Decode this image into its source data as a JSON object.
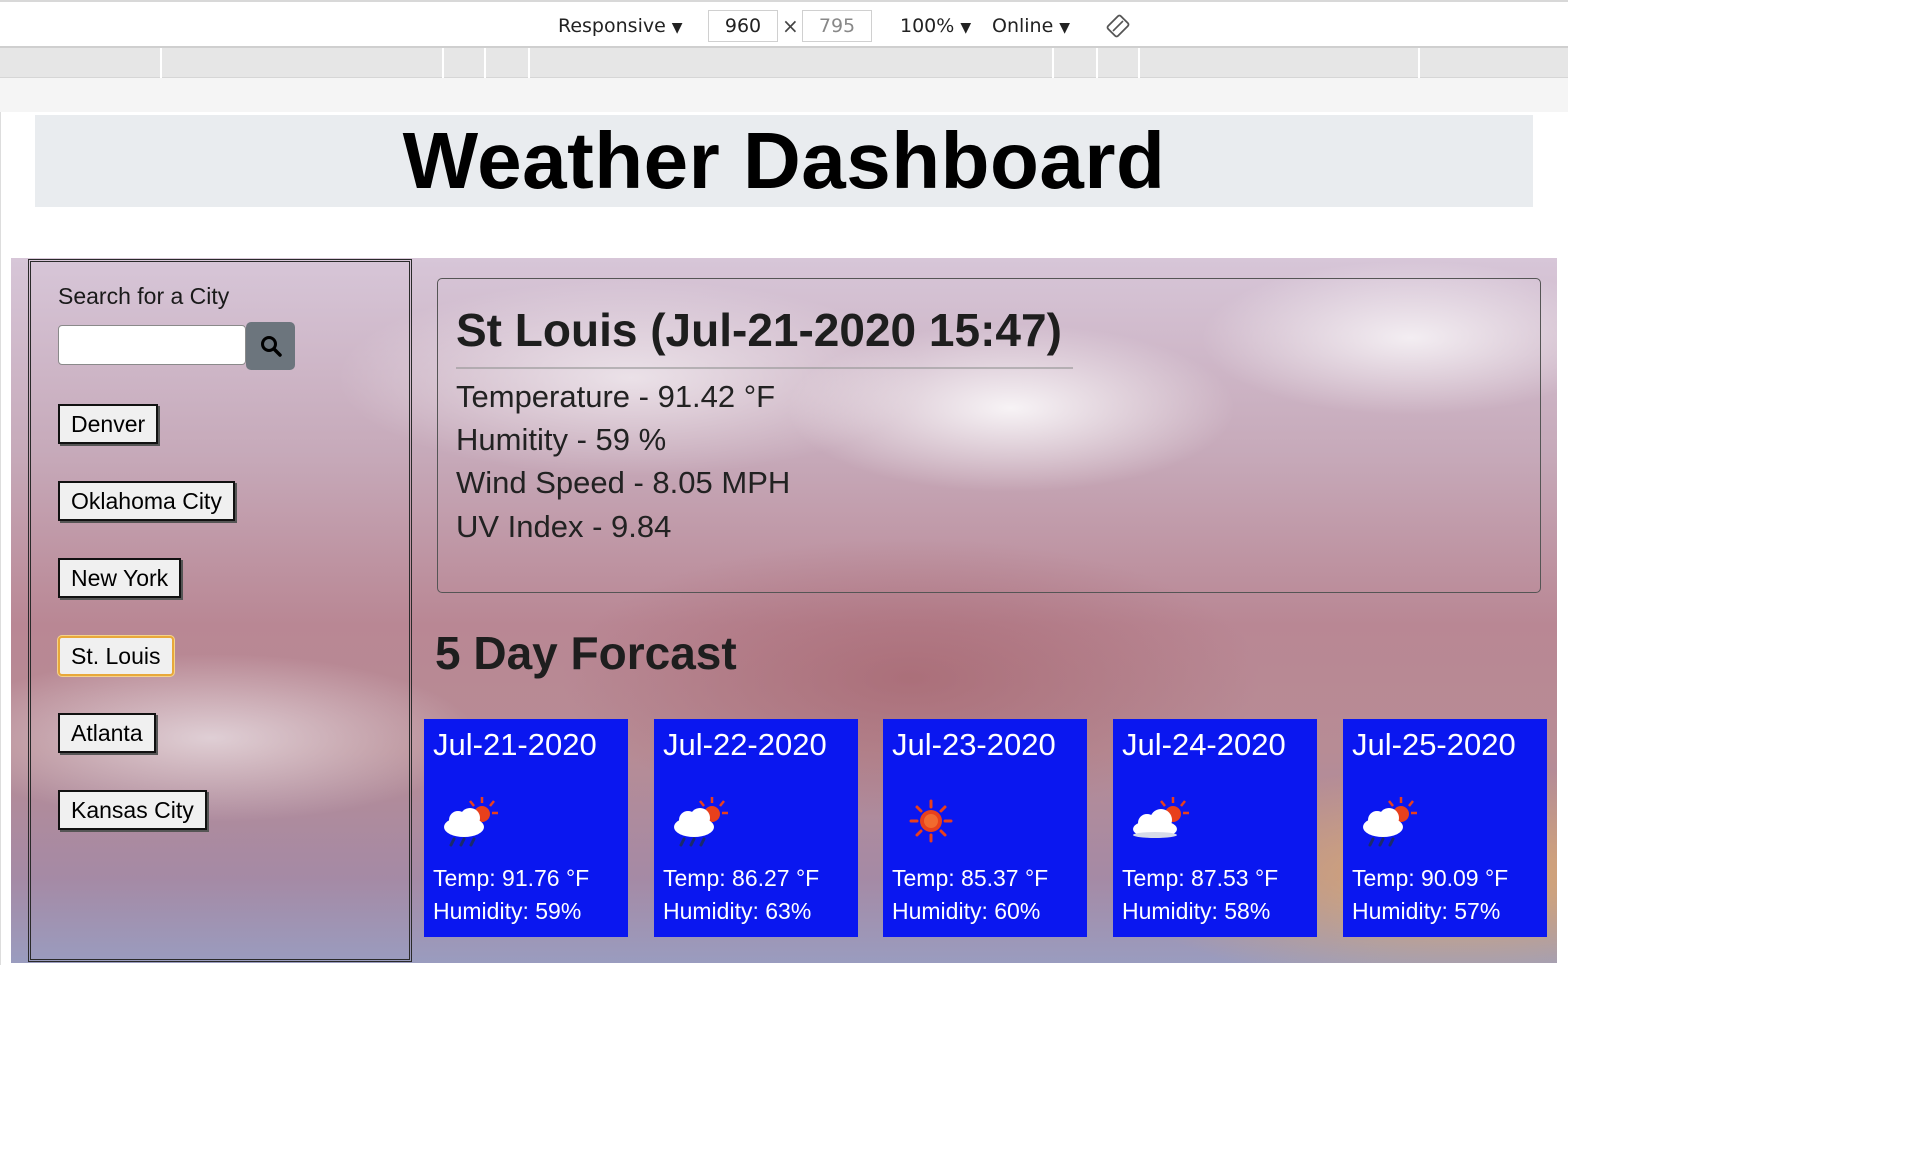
{
  "devtools": {
    "device": "Responsive",
    "width": "960",
    "height": "795",
    "zoom": "100%",
    "network": "Online"
  },
  "page": {
    "title": "Weather Dashboard"
  },
  "search": {
    "label": "Search for a City",
    "value": "",
    "placeholder": ""
  },
  "cities": [
    "Denver",
    "Oklahoma City",
    "New York",
    "St. Louis",
    "Atlanta",
    "Kansas City"
  ],
  "active_city": "St. Louis",
  "current": {
    "heading": "St Louis (Jul-21-2020 15:47)",
    "temperature": "Temperature - 91.42 °F",
    "humidity": "Humitity - 59 %",
    "wind": "Wind Speed - 8.05 MPH",
    "uv": "UV Index - 9.84"
  },
  "forecast": {
    "title": "5 Day Forcast",
    "days": [
      {
        "date": "Jul-21-2020",
        "icon": "rain-sun-icon",
        "temp": "Temp: 91.76 °F",
        "humidity": "Humidity: 59%"
      },
      {
        "date": "Jul-22-2020",
        "icon": "rain-sun-icon",
        "temp": "Temp: 86.27 °F",
        "humidity": "Humidity: 63%"
      },
      {
        "date": "Jul-23-2020",
        "icon": "sun-icon",
        "temp": "Temp: 85.37 °F",
        "humidity": "Humidity: 60%"
      },
      {
        "date": "Jul-24-2020",
        "icon": "cloud-sun-icon",
        "temp": "Temp: 87.53 °F",
        "humidity": "Humidity: 58%"
      },
      {
        "date": "Jul-25-2020",
        "icon": "rain-sun-icon",
        "temp": "Temp: 90.09 °F",
        "humidity": "Humidity: 57%"
      }
    ]
  },
  "colors": {
    "card_bg": "#0a17f0",
    "search_button": "#6c757d",
    "active_border": "#e8a83a"
  }
}
